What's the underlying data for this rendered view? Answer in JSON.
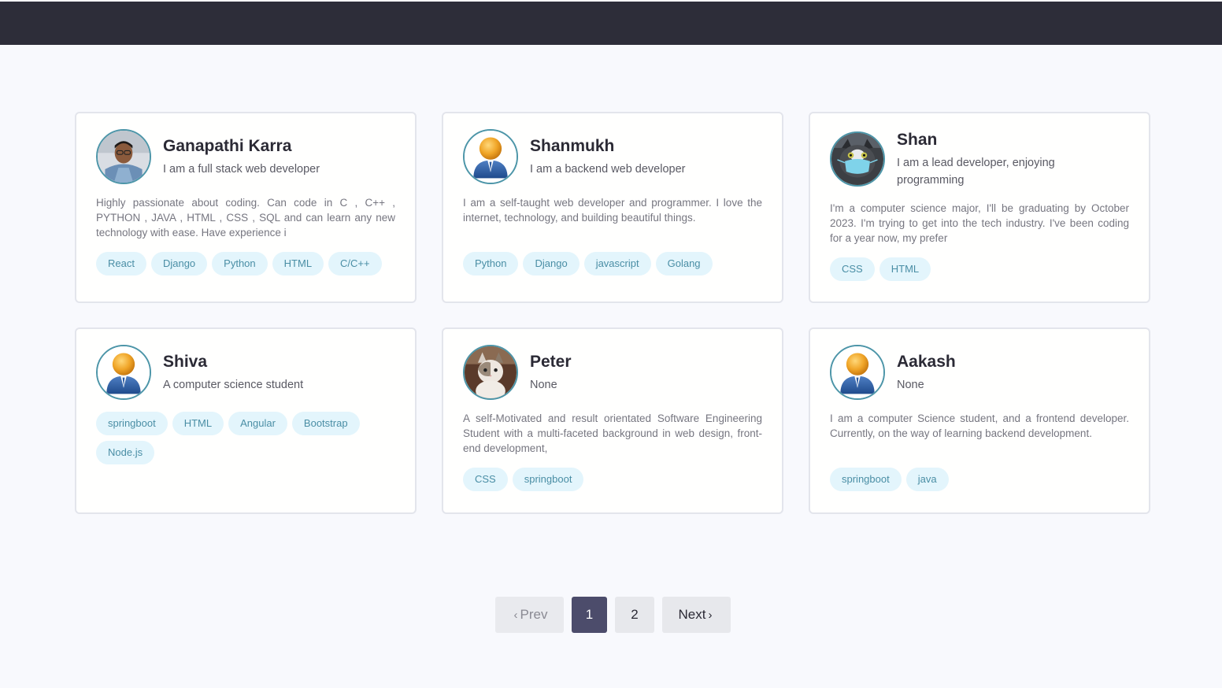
{
  "colors": {
    "topbar": "#2d2d39",
    "background": "#f8f9fd",
    "tag_bg": "#e3f5fc",
    "tag_text": "#4a8ea5",
    "active_page": "#4c4c6b"
  },
  "developers": [
    {
      "name": "Ganapathi Karra",
      "title": "I am a full stack web developer",
      "bio": "Highly passionate about coding. Can code in C , C++ , PYTHON , JAVA , HTML , CSS , SQL and can learn any new technology with ease. Have experience i",
      "avatar": "photo-man-icon",
      "tags": [
        "React",
        "Django",
        "Python",
        "HTML",
        "C/C++"
      ]
    },
    {
      "name": "Shanmukh",
      "title": "I am a backend web developer",
      "bio": "I am a self-taught web developer and programmer. I love the internet, technology, and building beautiful things.",
      "avatar": "default-user-icon",
      "tags": [
        "Python",
        "Django",
        "javascript",
        "Golang"
      ]
    },
    {
      "name": "Shan",
      "title": "I am a lead developer, enjoying programming",
      "bio": "I'm a computer science major, I'll be graduating by October 2023. I'm trying to get into the tech industry. I've been coding for a year now, my prefer",
      "avatar": "cat-mask-icon",
      "tags": [
        "CSS",
        "HTML"
      ]
    },
    {
      "name": "Shiva",
      "title": "A computer science student",
      "bio": "",
      "avatar": "default-user-icon",
      "tags": [
        "springboot",
        "HTML",
        "Angular",
        "Bootstrap",
        "Node.js"
      ]
    },
    {
      "name": "Peter",
      "title": "None",
      "bio": "A self-Motivated and result orientated Software Engineering Student with a multi-faceted background in web design, front-end development,",
      "avatar": "cat-photo-icon",
      "tags": [
        "CSS",
        "springboot"
      ]
    },
    {
      "name": "Aakash",
      "title": "None",
      "bio": "I am a computer Science student, and a frontend developer. Currently, on the way of learning backend development.",
      "avatar": "default-user-icon",
      "tags": [
        "springboot",
        "java"
      ]
    }
  ],
  "pagination": {
    "prev_label": "Prev",
    "next_label": "Next",
    "pages": [
      "1",
      "2"
    ],
    "current_page": "1"
  }
}
